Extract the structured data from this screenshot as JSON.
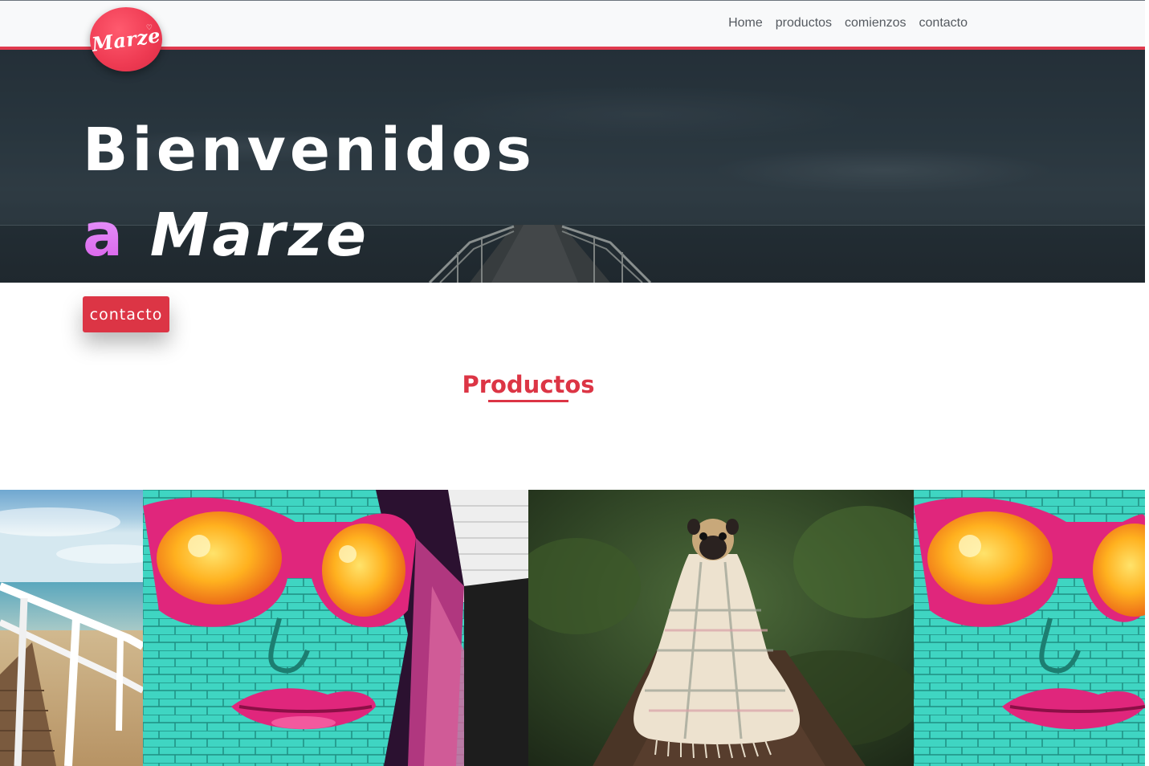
{
  "brand": {
    "logo_text": "Marze",
    "logo_color": "#ee3a52"
  },
  "nav": {
    "items": [
      {
        "label": "Home"
      },
      {
        "label": "productos"
      },
      {
        "label": "comienzos"
      },
      {
        "label": "contacto"
      }
    ]
  },
  "hero": {
    "line1": "Bienvenidos",
    "line2_prefix": "a",
    "line2_brand": "Marze",
    "cta_label": "contacto",
    "accent_color": "#dc3545"
  },
  "products": {
    "title": "Productos",
    "images": [
      {
        "name": "pier-image"
      },
      {
        "name": "graffiti-sunglasses-image"
      },
      {
        "name": "pug-blanket-image"
      },
      {
        "name": "graffiti-sunglasses-image"
      }
    ]
  }
}
